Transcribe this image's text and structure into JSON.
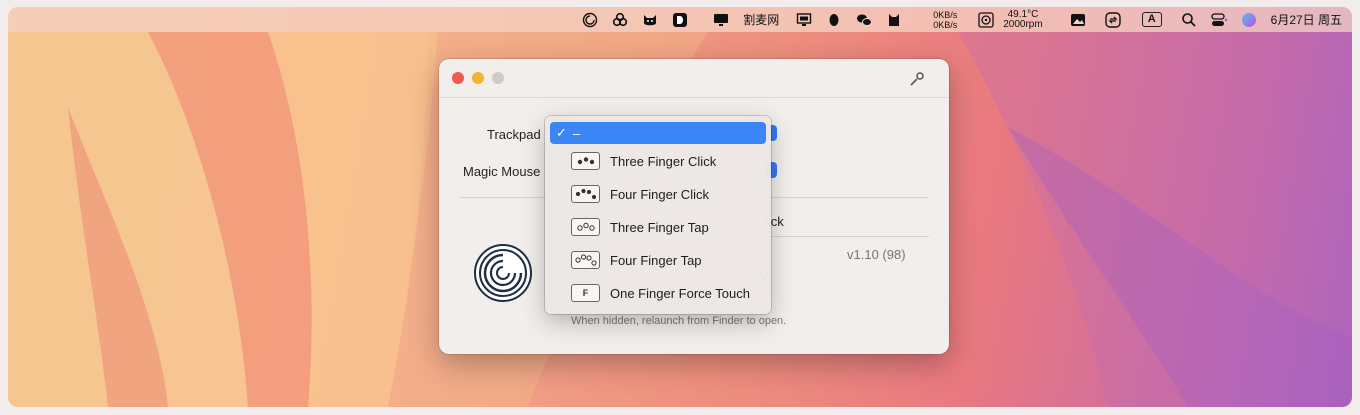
{
  "menubar": {
    "items": [
      "clock-spiral-icon",
      "links-icon",
      "cat-face-icon",
      "d-logo-icon",
      "monitor-icon"
    ],
    "app_name": "割麦网",
    "extra_icons": [
      "display-icon",
      "qq-icon",
      "wechat-icon",
      "cat-silhouette-icon"
    ],
    "net_up": "0KB/s",
    "net_down": "0KB/s",
    "temp": "49.1°C",
    "fan": "2000rpm",
    "input_method": "A",
    "date": "6月27日 周五"
  },
  "window": {
    "trackpad_label": "Trackpad",
    "magic_mouse_label": "Magic Mouse",
    "click_partial": "lick",
    "version": "v1.10 (98)",
    "hidden_partial": "y",
    "relaunch_note": "When hidden, relaunch from Finder to open."
  },
  "dropdown": {
    "selected_label": "–",
    "items": [
      {
        "label": "Three Finger Click",
        "icon": "three-finger-click-icon"
      },
      {
        "label": "Four Finger Click",
        "icon": "four-finger-click-icon"
      },
      {
        "label": "Three Finger Tap",
        "icon": "three-finger-tap-icon"
      },
      {
        "label": "Four Finger Tap",
        "icon": "four-finger-tap-icon"
      },
      {
        "label": "One Finger Force Touch",
        "icon": "force-touch-icon",
        "glyph": "F"
      }
    ]
  },
  "colors": {
    "accent": "#3b86f7",
    "close": "#ee5a52",
    "minimize": "#f4b22f",
    "zoom": "#cfcbc9"
  }
}
